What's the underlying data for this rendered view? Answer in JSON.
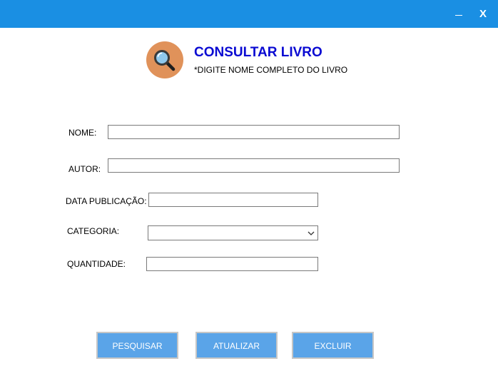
{
  "window": {
    "minimize_glyph": "",
    "close_glyph": "X",
    "titlebar_color": "#1a8fe3"
  },
  "header": {
    "icon": "magnifier-icon",
    "title": "CONSULTAR LIVRO",
    "subtitle": "*DIGITE NOME COMPLETO  DO LIVRO",
    "title_color": "#0a0ad2"
  },
  "form": {
    "nome_label": "NOME:",
    "nome_value": "",
    "autor_label": "AUTOR:",
    "autor_value": "",
    "data_label": "DATA PUBLICAÇÃO:",
    "data_value": "",
    "categoria_label": "CATEGORIA:",
    "categoria_value": "",
    "quantidade_label": "QUANTIDADE:",
    "quantidade_value": ""
  },
  "buttons": {
    "pesquisar": "PESQUISAR",
    "atualizar": "ATUALIZAR",
    "excluir": "EXCLUIR",
    "button_color": "#5aa4e8"
  }
}
